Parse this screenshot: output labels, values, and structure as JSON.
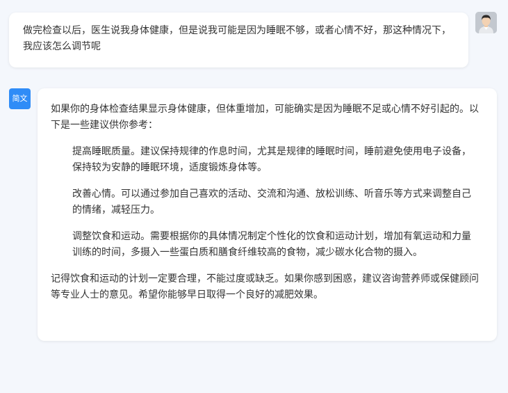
{
  "user_message": {
    "text": "做完检查以后，医生说我身体健康，但是说我可能是因为睡眠不够，或者心情不好，那这种情况下，我应该怎么调节呢"
  },
  "assistant": {
    "badge_label": "简文",
    "intro": "如果你的身体检查结果显示身体健康，但体重增加，可能确实是因为睡眠不足或心情不好引起的。以下是一些建议供你参考：",
    "items": [
      "提高睡眠质量。建议保持规律的作息时间，尤其是规律的睡眠时间，睡前避免使用电子设备，保持较为安静的睡眠环境，适度锻炼身体等。",
      "改善心情。可以通过参加自己喜欢的活动、交流和沟通、放松训练、听音乐等方式来调整自己的情绪，减轻压力。",
      "调整饮食和运动。需要根据你的具体情况制定个性化的饮食和运动计划，增加有氧运动和力量训练的时间，多摄入一些蛋白质和膳食纤维较高的食物，减少碳水化合物的摄入。"
    ],
    "closing": "记得饮食和运动的计划一定要合理，不能过度或缺乏。如果你感到困惑，建议咨询营养师或保健顾问等专业人士的意见。希望你能够早日取得一个良好的减肥效果。"
  },
  "colors": {
    "page_background": "#f4f7fc",
    "bubble_background": "#ffffff",
    "badge_blue": "#2f8cf7",
    "text": "#333333"
  },
  "icons": {
    "user_avatar": "user-avatar-icon"
  }
}
